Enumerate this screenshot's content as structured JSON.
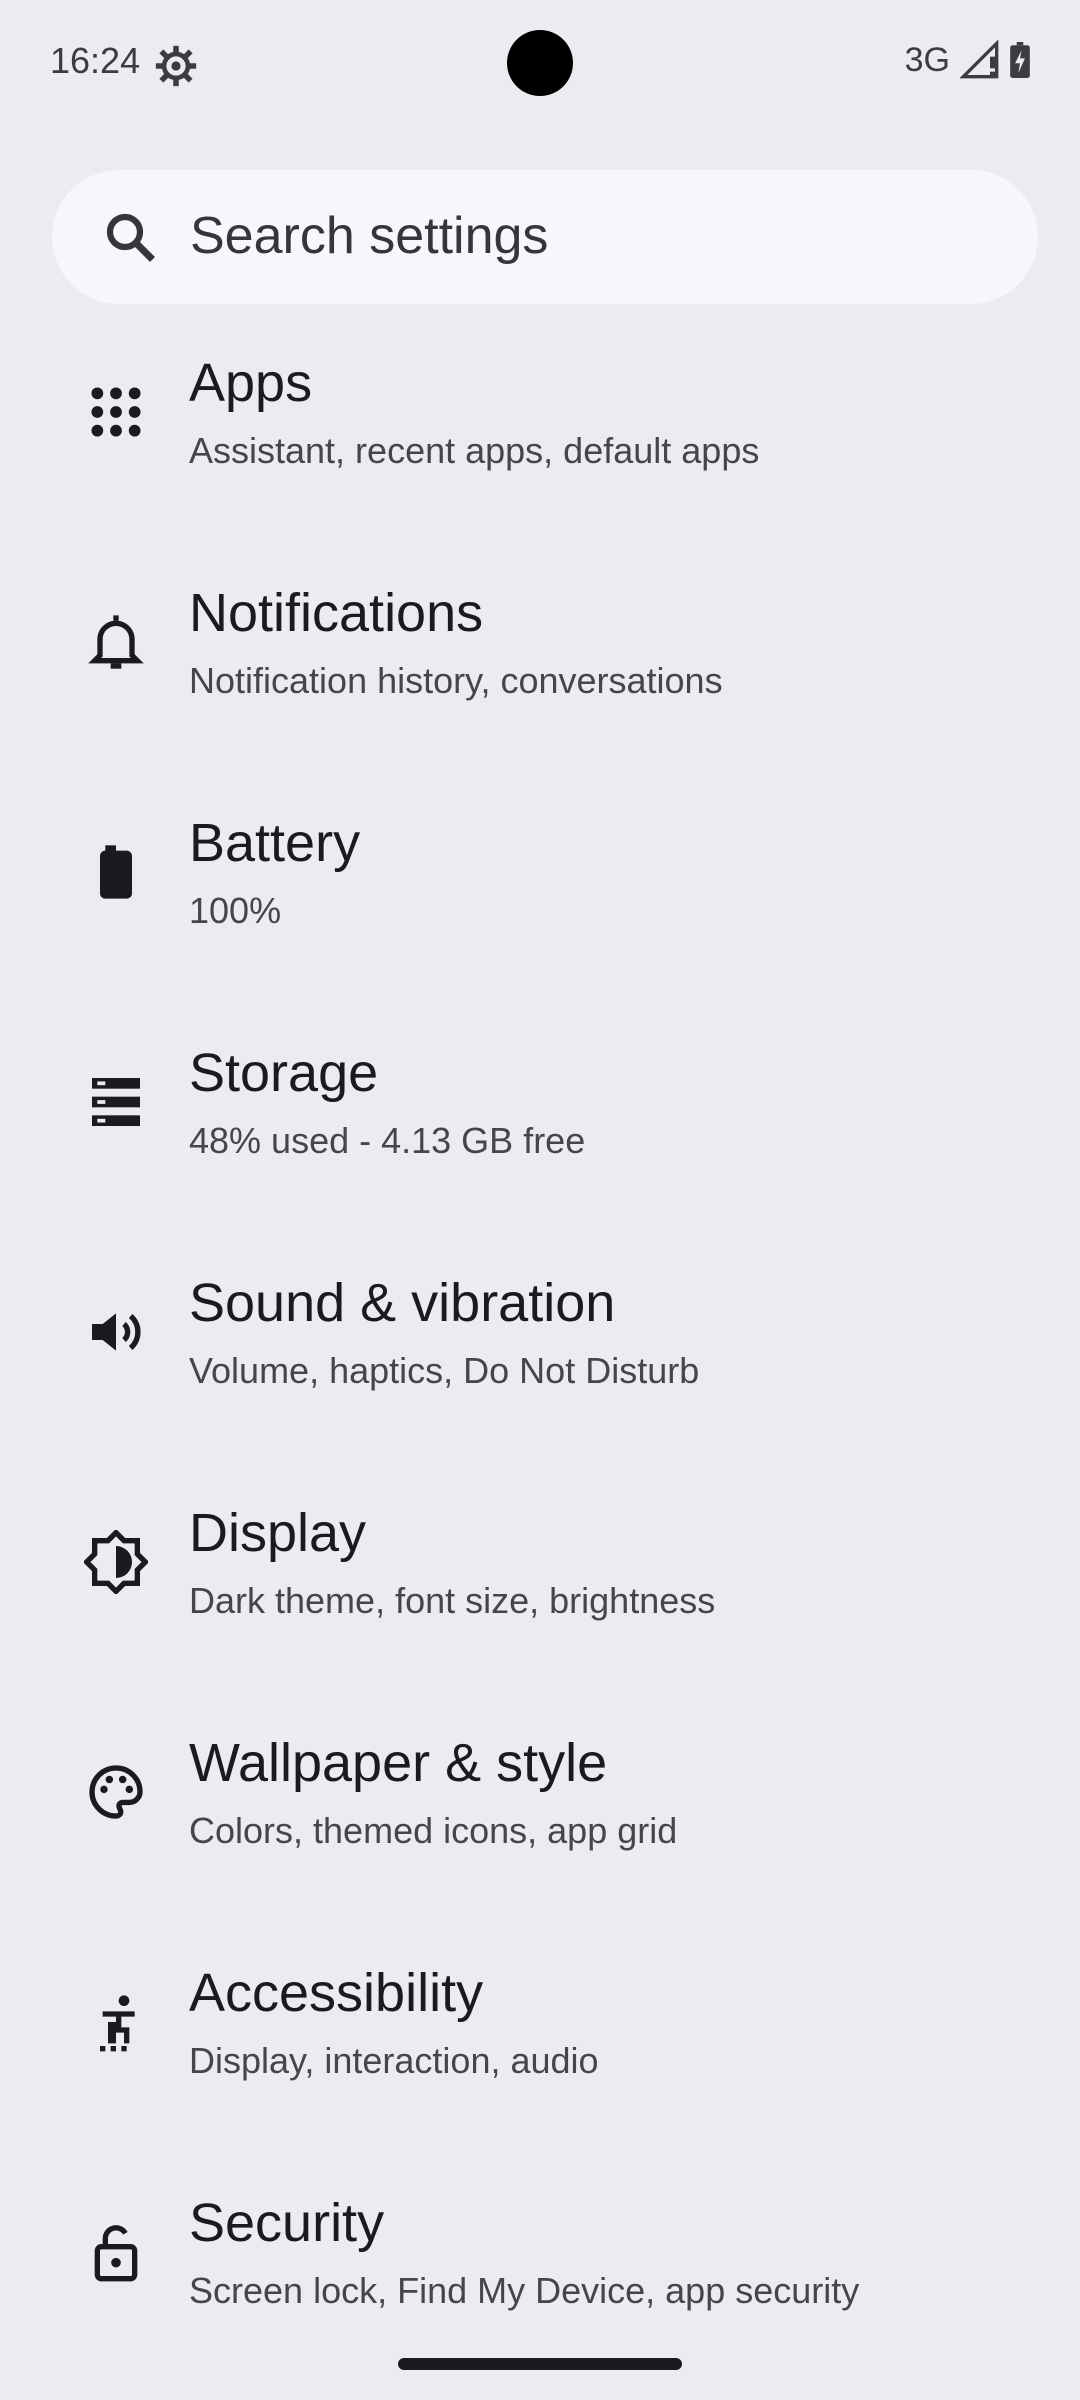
{
  "status_bar": {
    "time": "16:24",
    "network": "3G"
  },
  "search": {
    "label": "Search settings"
  },
  "items": [
    {
      "title": "Apps",
      "subtitle": "Assistant, recent apps, default apps",
      "icon": "apps-grid-icon"
    },
    {
      "title": "Notifications",
      "subtitle": "Notification history, conversations",
      "icon": "bell-icon"
    },
    {
      "title": "Battery",
      "subtitle": "100%",
      "icon": "battery-icon"
    },
    {
      "title": "Storage",
      "subtitle": "48% used - 4.13 GB free",
      "icon": "storage-icon"
    },
    {
      "title": "Sound & vibration",
      "subtitle": "Volume, haptics, Do Not Disturb",
      "icon": "speaker-icon"
    },
    {
      "title": "Display",
      "subtitle": "Dark theme, font size, brightness",
      "icon": "brightness-icon"
    },
    {
      "title": "Wallpaper & style",
      "subtitle": "Colors, themed icons, app grid",
      "icon": "palette-icon"
    },
    {
      "title": "Accessibility",
      "subtitle": "Display, interaction, audio",
      "icon": "accessibility-icon"
    },
    {
      "title": "Security",
      "subtitle": "Screen lock, Find My Device, app security",
      "icon": "lock-icon"
    }
  ]
}
